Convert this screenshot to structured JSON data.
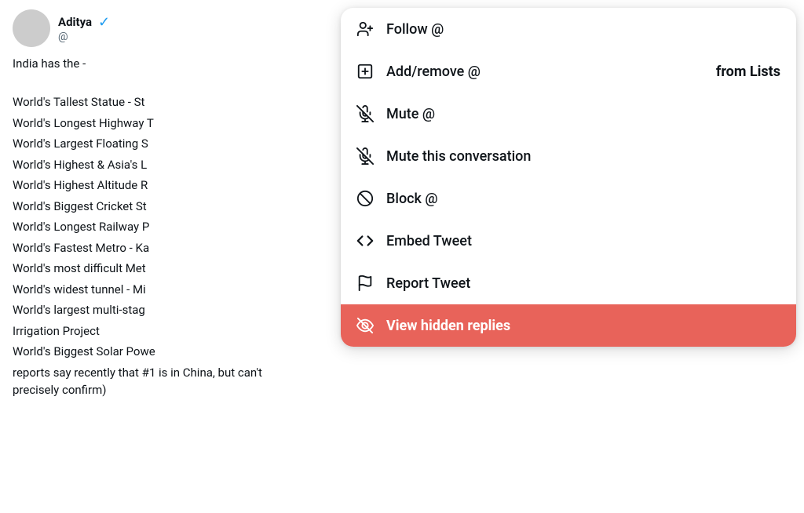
{
  "tweet": {
    "username": "Aditya",
    "handle": "@",
    "content_intro": "India has the -",
    "content_lines": [
      "World's Tallest Statue - St",
      "World's Longest Highway T",
      "World's Largest Floating S",
      "World's Highest & Asia's L",
      "World's Highest Altitude R",
      "World's Biggest Cricket St",
      "World's Longest Railway P",
      "World's Fastest Metro - Ka",
      "World's most difficult Met",
      "World's widest tunnel - Mi",
      "World's largest multi-stag",
      "Irrigation Project",
      "World's Biggest Solar Powe",
      "reports say recently that #1 is in China, but can't precisely confirm)"
    ]
  },
  "dropdown": {
    "items": [
      {
        "id": "follow",
        "icon": "person-add-icon",
        "label": "Follow @",
        "right_label": null,
        "style": "normal"
      },
      {
        "id": "add-remove",
        "icon": "list-add-icon",
        "label": "Add/remove @",
        "right_label": "from Lists",
        "style": "normal"
      },
      {
        "id": "mute",
        "icon": "mute-icon",
        "label": "Mute @",
        "right_label": null,
        "style": "normal"
      },
      {
        "id": "mute-conversation",
        "icon": "mute-convo-icon",
        "label": "Mute this conversation",
        "right_label": null,
        "style": "normal"
      },
      {
        "id": "block",
        "icon": "block-icon",
        "label": "Block @",
        "right_label": null,
        "style": "normal"
      },
      {
        "id": "embed-tweet",
        "icon": "embed-icon",
        "label": "Embed Tweet",
        "right_label": null,
        "style": "normal"
      },
      {
        "id": "report-tweet",
        "icon": "flag-icon",
        "label": "Report Tweet",
        "right_label": null,
        "style": "normal"
      },
      {
        "id": "view-hidden",
        "icon": "hidden-replies-icon",
        "label": "View hidden replies",
        "right_label": null,
        "style": "red"
      }
    ]
  }
}
